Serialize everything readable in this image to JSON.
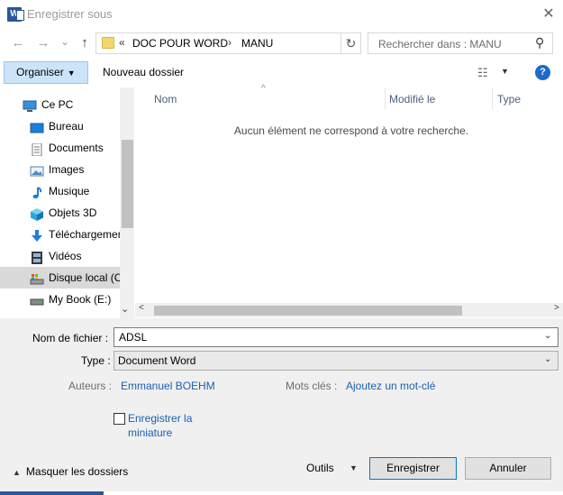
{
  "window": {
    "title": "Enregistrer sous",
    "close_glyph": "✕",
    "app_icon_letter": "W"
  },
  "nav": {
    "back_glyph": "←",
    "forward_glyph": "→",
    "recent_glyph": "⌄",
    "up_glyph": "↑",
    "address": {
      "overflow_glyph": "«",
      "crumbs": [
        "DOC POUR WORD",
        "MANU"
      ],
      "separator": "›"
    },
    "refresh_glyph": "↻",
    "search": {
      "placeholder": "Rechercher dans : MANU",
      "icon_glyph": "⚲"
    }
  },
  "toolbar": {
    "organize_label": "Organiser",
    "organize_arrow": "▼",
    "new_folder_label": "Nouveau dossier",
    "view_glyph": "☷",
    "view_drop_glyph": "▼",
    "help_glyph": "?"
  },
  "sidebar": {
    "items": [
      {
        "label": "Ce PC",
        "icon": "computer-icon"
      },
      {
        "label": "Bureau",
        "icon": "desktop-icon"
      },
      {
        "label": "Documents",
        "icon": "documents-icon"
      },
      {
        "label": "Images",
        "icon": "images-icon"
      },
      {
        "label": "Musique",
        "icon": "music-icon"
      },
      {
        "label": "Objets 3D",
        "icon": "3d-objects-icon"
      },
      {
        "label": "Téléchargements",
        "icon": "downloads-icon"
      },
      {
        "label": "Vidéos",
        "icon": "videos-icon"
      },
      {
        "label": "Disque local (C:)",
        "icon": "local-disk-icon"
      },
      {
        "label": "My Book (E:)",
        "icon": "external-drive-icon"
      }
    ],
    "scroll_down_glyph": "⌄"
  },
  "file_list": {
    "columns": [
      "Nom",
      "Modifié le",
      "Type"
    ],
    "sort_glyph": "^",
    "empty_message": "Aucun élément ne correspond à votre recherche.",
    "hscroll_left": "<",
    "hscroll_right": ">"
  },
  "form": {
    "filename_label": "Nom de fichier :",
    "filename_value": "ADSL",
    "filetype_label": "Type :",
    "filetype_value": "Document Word",
    "authors_label": "Auteurs :",
    "authors_value": "Emmanuel BOEHM",
    "keywords_label": "Mots clés :",
    "keywords_value": "Ajoutez un mot-clé",
    "thumbnail_label": "Enregistrer la miniature",
    "dropdown_glyph": "⌄"
  },
  "footer": {
    "hide_folders_glyph": "▲",
    "hide_folders_label": "Masquer les dossiers",
    "tools_label": "Outils",
    "tools_drop_glyph": "▼",
    "save_label": "Enregistrer",
    "cancel_label": "Annuler"
  },
  "colors": {
    "accent": "#0078d7",
    "link": "#1a5fb4",
    "selected_row": "#d9d9d9",
    "word_blue": "#2b579a"
  }
}
